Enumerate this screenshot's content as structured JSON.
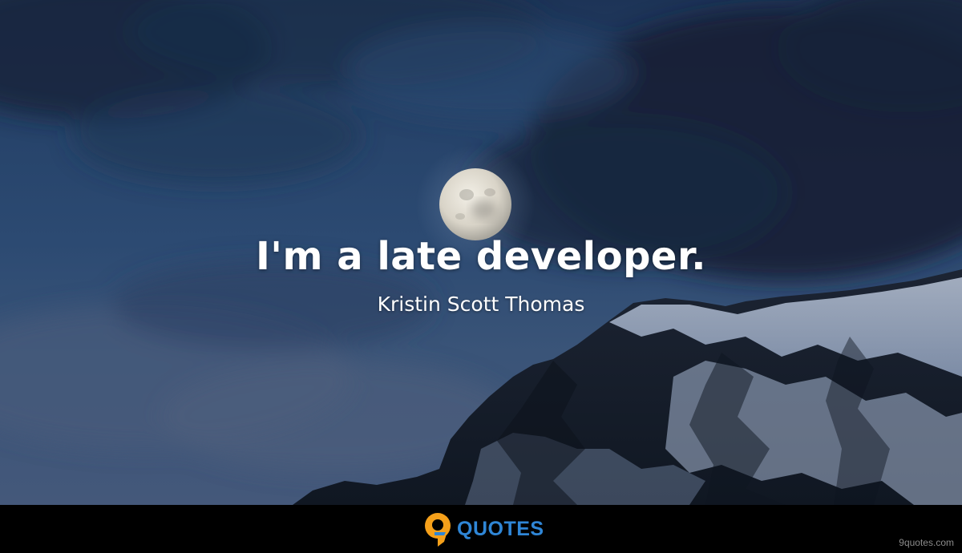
{
  "quote": {
    "text": "I'm a late developer.",
    "author": "Kristin Scott Thomas"
  },
  "footer": {
    "logo_text": "QUOTES",
    "logo_icon": "nine-icon",
    "site": "9quotes.com"
  },
  "colors": {
    "sky": "#27446b",
    "logo_orange": "#f5a01a",
    "logo_blue": "#2f86d6",
    "footer_bg": "#000000"
  }
}
